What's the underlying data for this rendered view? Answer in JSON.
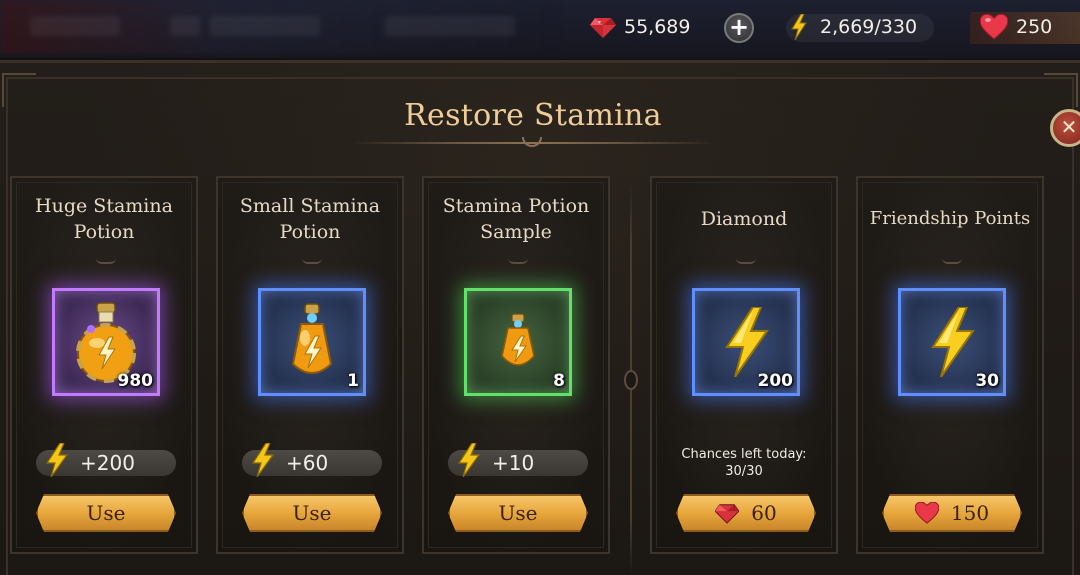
{
  "topbar": {
    "rubies": "55,689",
    "stamina": "2,669/330",
    "hearts": "250"
  },
  "dialog": {
    "title": "Restore Stamina"
  },
  "cards": [
    {
      "title_line1": "Huge Stamina",
      "title_line2": "Potion",
      "count": "980",
      "effect": "+200",
      "button": "Use",
      "frame": "purple"
    },
    {
      "title_line1": "Small Stamina",
      "title_line2": "Potion",
      "count": "1",
      "effect": "+60",
      "button": "Use",
      "frame": "blue"
    },
    {
      "title_line1": "Stamina Potion",
      "title_line2": "Sample",
      "count": "8",
      "effect": "+10",
      "button": "Use",
      "frame": "green"
    },
    {
      "title": "Diamond",
      "count": "200",
      "chances_label": "Chances left today:",
      "chances_value": "30/30",
      "cost": "60",
      "frame": "blue"
    },
    {
      "title": "Friendship Points",
      "count": "30",
      "cost": "150",
      "frame": "blue"
    }
  ],
  "icons": {
    "ruby": "ruby-icon",
    "bolt": "lightning-bolt-icon",
    "heart": "heart-icon",
    "potion": "potion-icon"
  },
  "colors": {
    "title": "#f0cd98",
    "button": "#e8a73d",
    "purple_frame": "#c27bff",
    "blue_frame": "#5f8fff",
    "green_frame": "#63e06a"
  }
}
